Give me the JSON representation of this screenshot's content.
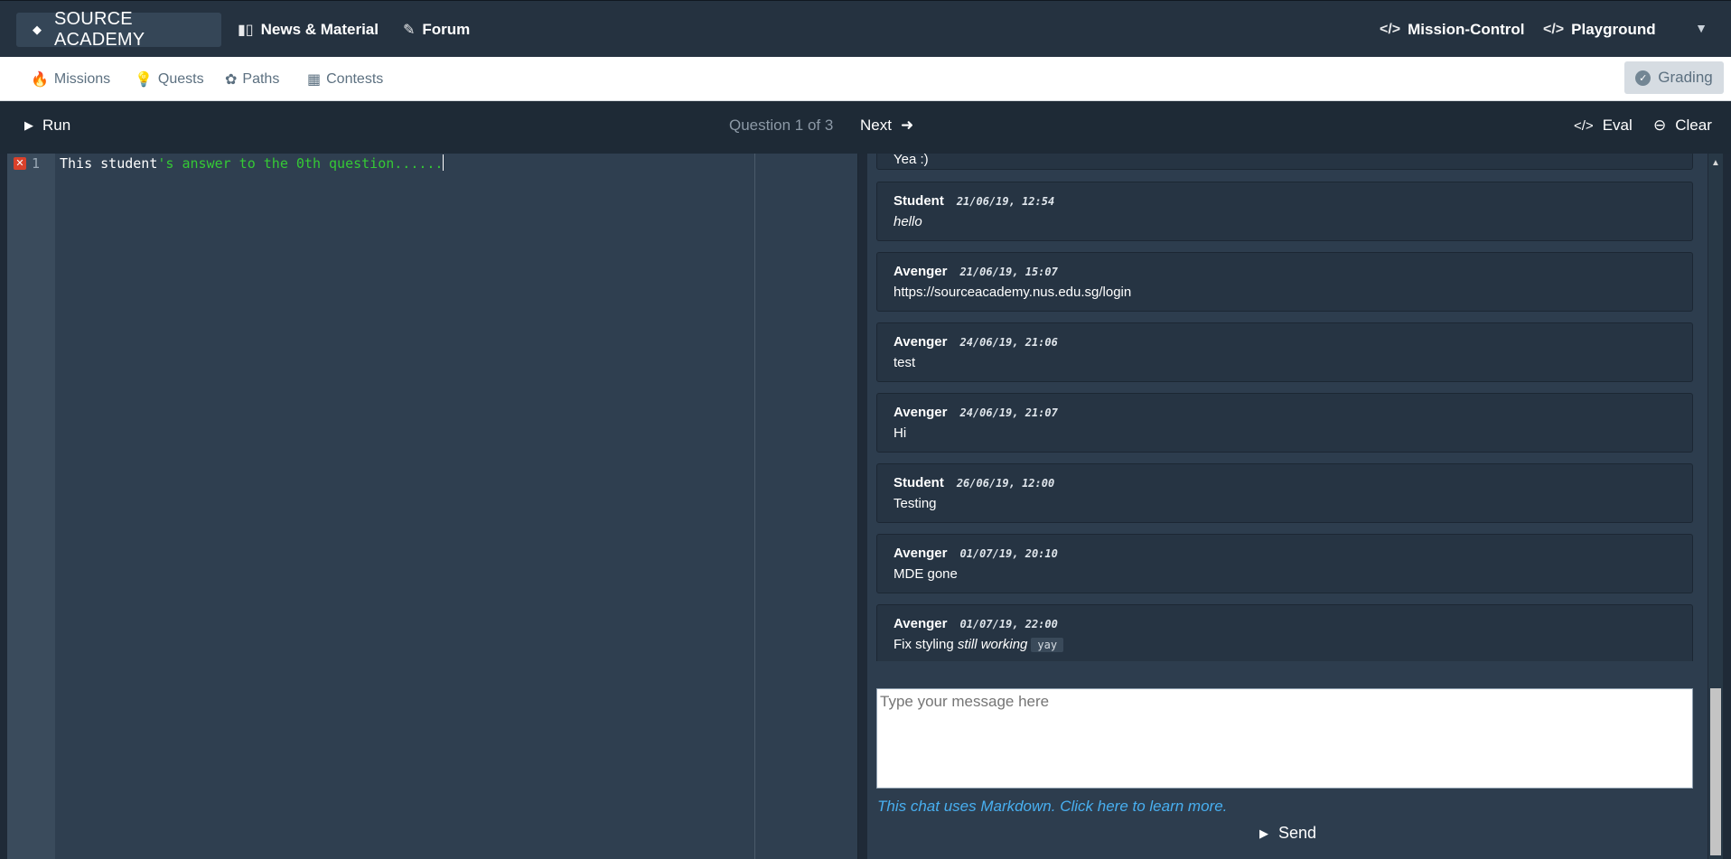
{
  "nav": {
    "brand": "SOURCE ACADEMY",
    "news": "News & Material",
    "forum": "Forum",
    "mission_control": "Mission-Control",
    "playground": "Playground"
  },
  "subnav": {
    "missions": "Missions",
    "quests": "Quests",
    "paths": "Paths",
    "contests": "Contests",
    "grading": "Grading"
  },
  "toolbar": {
    "run": "Run",
    "question_counter": "Question 1 of 3",
    "next": "Next",
    "eval": "Eval",
    "clear": "Clear"
  },
  "editor": {
    "line_number": "1",
    "code_plain": "This student",
    "code_string": "'s answer to the 0th question......"
  },
  "chat": {
    "partial_text": "Yea :)",
    "messages": [
      {
        "author": "Student",
        "time": "21/06/19, 12:54",
        "text": "hello"
      },
      {
        "author": "Avenger",
        "time": "21/06/19, 15:07",
        "text": "https://sourceacademy.nus.edu.sg/login"
      },
      {
        "author": "Avenger",
        "time": "24/06/19, 21:06",
        "text": "test"
      },
      {
        "author": "Avenger",
        "time": "24/06/19, 21:07",
        "text": "Hi"
      },
      {
        "author": "Student",
        "time": "26/06/19, 12:00",
        "text": "Testing"
      },
      {
        "author": "Avenger",
        "time": "01/07/19, 20:10",
        "text": "MDE gone"
      },
      {
        "author": "Avenger",
        "time": "01/07/19, 22:00",
        "text_prefix": "Fix styling",
        "text_em": "still working",
        "text_code": "yay"
      }
    ],
    "input_placeholder": "Type your message here",
    "markdown_note": "This chat uses Markdown. Click here to learn more.",
    "send": "Send"
  }
}
